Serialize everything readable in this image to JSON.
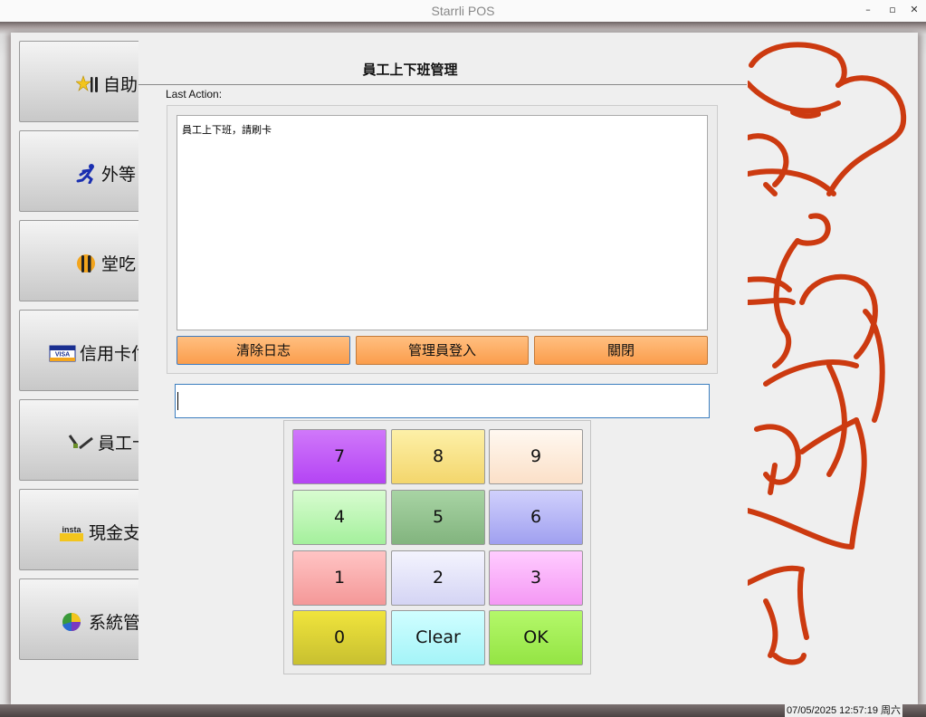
{
  "window": {
    "title": "Starrli POS",
    "minimize": "–",
    "maximize": "▫",
    "close": "✕"
  },
  "menu": [
    {
      "label": "自助",
      "icon": "star-utensils-icon"
    },
    {
      "label": "外等",
      "icon": "running-man-icon"
    },
    {
      "label": "堂吃",
      "icon": "fork-knife-icon"
    },
    {
      "label": "信用卡付",
      "icon": "visa-card-icon"
    },
    {
      "label": "員工卡",
      "icon": "card-swipe-icon"
    },
    {
      "label": "現金支",
      "icon": "insta-cash-icon"
    },
    {
      "label": "系統管",
      "icon": "pie-chart-icon"
    }
  ],
  "dialog": {
    "title": "員工上下班管理",
    "last_action_label": "Last Action:",
    "log_text": "員工上下班，請刷卡",
    "buttons": {
      "clear_log": "清除日志",
      "admin_login": "管理員登入",
      "close": "關閉"
    },
    "input_value": "",
    "keypad": [
      "7",
      "8",
      "9",
      "4",
      "5",
      "6",
      "1",
      "2",
      "3",
      "0",
      "Clear",
      "OK"
    ]
  },
  "status": {
    "datetime": "07/05/2025 12:57:19 周六"
  },
  "colors": {
    "action_button": "#fb9d4c",
    "key_7": "#c050f8",
    "key_8": "#f8e080",
    "key_9": "#fbe7d6",
    "key_4": "#b8f8b0",
    "key_5": "#8fc08c",
    "key_6": "#b0b0f8",
    "key_1": "#fba6a6",
    "key_2": "#e0e0f8",
    "key_3": "#f8a8f8",
    "key_0": "#d8d030",
    "key_clear": "#b0f8f8",
    "key_ok": "#a0f050",
    "chef_outline": "#cc3a10"
  }
}
